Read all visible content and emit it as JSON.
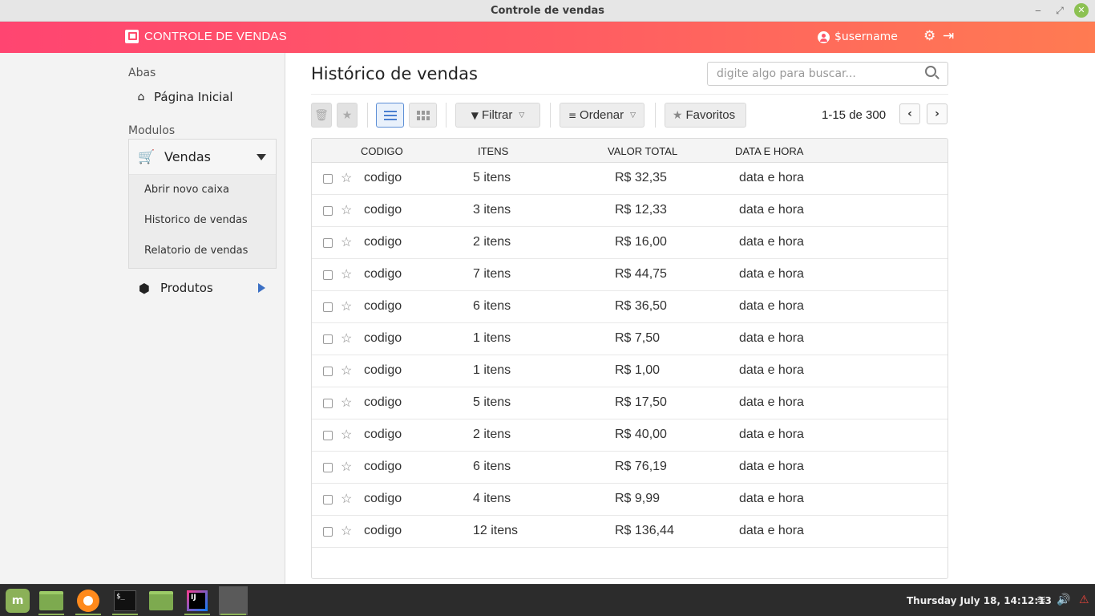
{
  "window": {
    "title": "Controle de vendas"
  },
  "header": {
    "brand": "CONTROLE DE VENDAS",
    "username": "$username"
  },
  "sidebar": {
    "abas_label": "Abas",
    "home": "Página Inicial",
    "modulos_label": "Modulos",
    "vendas": {
      "label": "Vendas",
      "items": [
        "Abrir novo caixa",
        "Historico de vendas",
        "Relatorio de vendas"
      ]
    },
    "produtos": "Produtos"
  },
  "main": {
    "title": "Histórico de vendas",
    "search_placeholder": "digite algo para buscar...",
    "toolbar": {
      "filter": "Filtrar",
      "order": "Ordenar",
      "favorites": "Favoritos"
    },
    "pagination": "1-15 de 300",
    "table": {
      "headers": [
        "CODIGO",
        "ITENS",
        "VALOR TOTAL",
        "DATA E HORA"
      ],
      "rows": [
        [
          "codigo",
          "5 itens",
          "R$ 32,35",
          "data e hora"
        ],
        [
          "codigo",
          "3 itens",
          "R$ 12,33",
          "data e hora"
        ],
        [
          "codigo",
          "2 itens",
          "R$ 16,00",
          "data e hora"
        ],
        [
          "codigo",
          "7 itens",
          "R$ 44,75",
          "data e hora"
        ],
        [
          "codigo",
          "6 itens",
          "R$ 36,50",
          "data e hora"
        ],
        [
          "codigo",
          "1 itens",
          "R$ 7,50",
          "data e hora"
        ],
        [
          "codigo",
          "1 itens",
          "R$ 1,00",
          "data e hora"
        ],
        [
          "codigo",
          "5 itens",
          "R$ 17,50",
          "data e hora"
        ],
        [
          "codigo",
          "2 itens",
          "R$ 40,00",
          "data e hora"
        ],
        [
          "codigo",
          "6 itens",
          "R$ 76,19",
          "data e hora"
        ],
        [
          "codigo",
          "4 itens",
          "R$ 9,99",
          "data e hora"
        ],
        [
          "codigo",
          "12 itens",
          "R$ 136,44",
          "data e hora"
        ]
      ]
    }
  },
  "taskbar": {
    "clock": "Thursday July 18, 14:12:13",
    "apps": [
      "mint-menu-icon",
      "files-icon",
      "firefox-icon",
      "terminal-icon",
      "folder-icon",
      "intellij-icon",
      "app-window-icon"
    ]
  },
  "colors": {
    "header_start": "#ff4571",
    "header_end": "#ff7b52",
    "accent_blue": "#4a7fd0"
  }
}
